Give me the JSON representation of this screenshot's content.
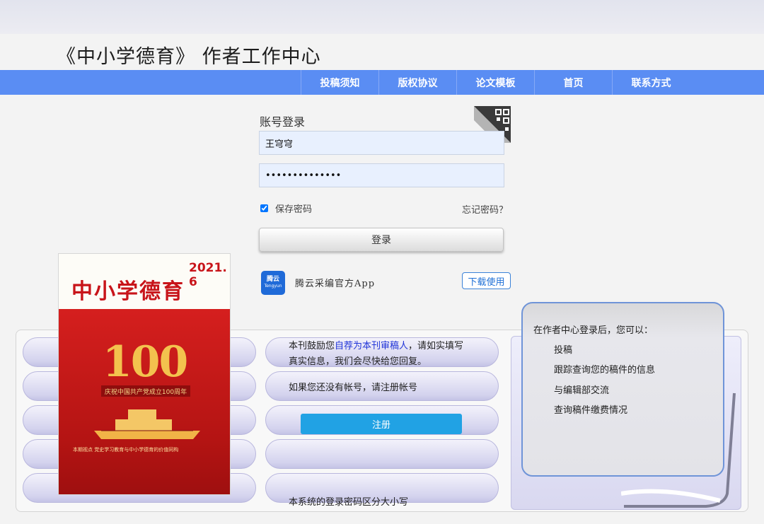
{
  "header": {
    "title": "《中小学德育》 作者工作中心"
  },
  "nav": {
    "items": [
      "投稿须知",
      "版权协议",
      "论文模板",
      "首页",
      "联系方式"
    ]
  },
  "login": {
    "heading": "账号登录",
    "username_value": "王穹穹",
    "password_value": "••••••••••••••",
    "remember_label": "保存密码",
    "forgot_label": "忘记密码？",
    "login_button": "登录"
  },
  "app": {
    "logo_text": "腾云",
    "logo_sub": "Tengyun",
    "name": "腾云采编官方App",
    "download_button": "下载使用"
  },
  "cover": {
    "title": "中小学德育",
    "issue": "2021. 6",
    "number": "100",
    "caption": "庆祝中国共产党成立100周年",
    "focus_line": "本期视点 党史学习教育与中小学德育的价值同构"
  },
  "middle": {
    "intro_prefix": "本刊鼓励您",
    "intro_link": "自荐为本刊审稿人",
    "intro_suffix": "，请如实填写",
    "intro_line2": "真实信息，我们会尽快给您回复。",
    "no_account": "如果您还没有帐号，请注册帐号",
    "register_button": "注册",
    "case_note": "本系统的登录密码区分大小写"
  },
  "info_panel": {
    "title": "在作者中心登录后，您可以：",
    "items": [
      "投稿",
      "跟踪查询您的稿件的信息",
      "与编辑部交流",
      "查询稿件缴费情况"
    ]
  }
}
